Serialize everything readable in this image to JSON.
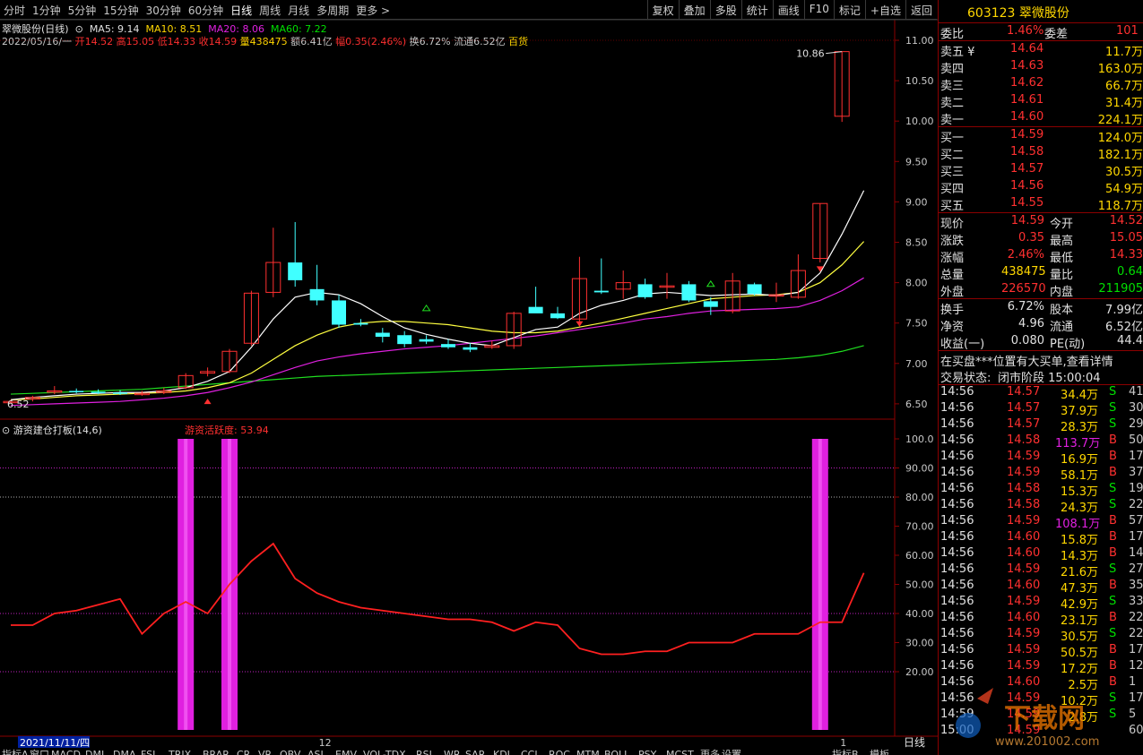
{
  "toolbar": {
    "periods": [
      "分时",
      "1分钟",
      "5分钟",
      "15分钟",
      "30分钟",
      "60分钟",
      "日线",
      "周线",
      "月线",
      "多周期",
      "更多 >"
    ],
    "active_period": "日线",
    "buttons": [
      "复权",
      "叠加",
      "多股",
      "统计",
      "画线",
      "F10",
      "标记",
      "+自选",
      "返回"
    ]
  },
  "chart": {
    "stock_label": "翠微股份(日线)",
    "ma5": "MA5: 9.14",
    "ma10": "MA10: 8.51",
    "ma20": "MA20: 8.06",
    "ma60": "MA60: 7.22",
    "date_line": "2022/05/16/一",
    "open": "开14.52",
    "high": "高15.05",
    "low": "低14.33",
    "close": "收14.59",
    "volume": "量438475",
    "amount": "额6.41亿",
    "change": "幅0.35(2.46%)",
    "turnover": "换6.72%",
    "float": "流通6.52亿",
    "type": "百货",
    "price_axis": [
      "11.00",
      "10.50",
      "10.00",
      "9.50",
      "9.00",
      "8.50",
      "8.00",
      "7.50",
      "7.00",
      "6.50"
    ],
    "high_label": "10.86",
    "low_label": "6.52",
    "colors": {
      "up": "#ff3030",
      "down": "#40ffff",
      "ma5": "#ffffff",
      "ma10": "#ffff40",
      "ma20": "#e020e0",
      "ma60": "#20e020"
    }
  },
  "indicator": {
    "title": "游资建仓打板(14,6)",
    "value_label": "游资活跃度: 53.94",
    "axis": [
      "100.0",
      "90.00",
      "80.00",
      "70.00",
      "60.00",
      "50.00",
      "40.00",
      "30.00",
      "20.00"
    ]
  },
  "bottom": {
    "date_cursor": "2021/11/11/四",
    "month_12": "12",
    "month_1": "1",
    "period_label": "日线",
    "tabs": [
      "指标A",
      "窗口",
      "MACD",
      "DMI",
      "DMA",
      "FSL",
      "TRIX",
      "BRAR",
      "CR",
      "VR",
      "OBV",
      "ASI",
      "EMV",
      "VOL-TDX",
      "RSI",
      "WR",
      "SAR",
      "KDJ",
      "CCI",
      "ROC",
      "MTM",
      "BOLL",
      "PSY",
      "MCST",
      "更多",
      "设置"
    ],
    "tabs_right": [
      "指标B",
      "模板"
    ]
  },
  "quote": {
    "code": "603123",
    "name": "翠微股份",
    "weibi_label": "委比",
    "weibi": "1.46%",
    "weicha_label": "委差",
    "weicha": "101",
    "asks": [
      {
        "label": "卖五",
        "price": "14.64",
        "vol": "11.7万",
        "mark": "¥"
      },
      {
        "label": "卖四",
        "price": "14.63",
        "vol": "163.0万"
      },
      {
        "label": "卖三",
        "price": "14.62",
        "vol": "66.7万"
      },
      {
        "label": "卖二",
        "price": "14.61",
        "vol": "31.4万"
      },
      {
        "label": "卖一",
        "price": "14.60",
        "vol": "224.1万"
      }
    ],
    "bids": [
      {
        "label": "买一",
        "price": "14.59",
        "vol": "124.0万"
      },
      {
        "label": "买二",
        "price": "14.58",
        "vol": "182.1万"
      },
      {
        "label": "买三",
        "price": "14.57",
        "vol": "30.5万"
      },
      {
        "label": "买四",
        "price": "14.56",
        "vol": "54.9万"
      },
      {
        "label": "买五",
        "price": "14.55",
        "vol": "118.7万"
      }
    ],
    "stats": [
      {
        "l1": "现价",
        "v1": "14.59",
        "l2": "今开",
        "v2": "14.52",
        "c1": "red",
        "c2": "red"
      },
      {
        "l1": "涨跌",
        "v1": "0.35",
        "l2": "最高",
        "v2": "15.05",
        "c1": "red",
        "c2": "red"
      },
      {
        "l1": "涨幅",
        "v1": "2.46%",
        "l2": "最低",
        "v2": "14.33",
        "c1": "red",
        "c2": "red"
      },
      {
        "l1": "总量",
        "v1": "438475",
        "l2": "量比",
        "v2": "0.64",
        "c1": "yellow",
        "c2": "green"
      },
      {
        "l1": "外盘",
        "v1": "226570",
        "l2": "内盘",
        "v2": "211905",
        "c1": "red",
        "c2": "green"
      }
    ],
    "stats2": [
      {
        "l1": "换手",
        "v1": "6.72%",
        "l2": "股本",
        "v2": "7.99亿"
      },
      {
        "l1": "净资",
        "v1": "4.96",
        "l2": "流通",
        "v2": "6.52亿"
      },
      {
        "l1": "收益(一)",
        "v1": "0.080",
        "l2": "PE(动)",
        "v2": "44.4"
      }
    ],
    "notice": "在买盘***位置有大买单,查看详情",
    "status_label": "交易状态:",
    "status": "闭市阶段 15:00:04",
    "ticks": [
      {
        "t": "14:56",
        "p": "14.57",
        "v": "34.4万",
        "s": "S",
        "n": "41"
      },
      {
        "t": "14:56",
        "p": "14.57",
        "v": "37.9万",
        "s": "S",
        "n": "30"
      },
      {
        "t": "14:56",
        "p": "14.57",
        "v": "28.3万",
        "s": "S",
        "n": "29"
      },
      {
        "t": "14:56",
        "p": "14.58",
        "v": "113.7万",
        "s": "B",
        "n": "50"
      },
      {
        "t": "14:56",
        "p": "14.59",
        "v": "16.9万",
        "s": "B",
        "n": "17"
      },
      {
        "t": "14:56",
        "p": "14.59",
        "v": "58.1万",
        "s": "B",
        "n": "37"
      },
      {
        "t": "14:56",
        "p": "14.58",
        "v": "15.3万",
        "s": "S",
        "n": "19"
      },
      {
        "t": "14:56",
        "p": "14.58",
        "v": "24.3万",
        "s": "S",
        "n": "22"
      },
      {
        "t": "14:56",
        "p": "14.59",
        "v": "108.1万",
        "s": "B",
        "n": "57"
      },
      {
        "t": "14:56",
        "p": "14.60",
        "v": "15.8万",
        "s": "B",
        "n": "17"
      },
      {
        "t": "14:56",
        "p": "14.60",
        "v": "14.3万",
        "s": "B",
        "n": "14"
      },
      {
        "t": "14:56",
        "p": "14.59",
        "v": "21.6万",
        "s": "S",
        "n": "27"
      },
      {
        "t": "14:56",
        "p": "14.60",
        "v": "47.3万",
        "s": "B",
        "n": "35"
      },
      {
        "t": "14:56",
        "p": "14.59",
        "v": "42.9万",
        "s": "S",
        "n": "33"
      },
      {
        "t": "14:56",
        "p": "14.60",
        "v": "23.1万",
        "s": "B",
        "n": "22"
      },
      {
        "t": "14:56",
        "p": "14.59",
        "v": "30.5万",
        "s": "S",
        "n": "22"
      },
      {
        "t": "14:56",
        "p": "14.59",
        "v": "50.5万",
        "s": "B",
        "n": "17"
      },
      {
        "t": "14:56",
        "p": "14.59",
        "v": "17.2万",
        "s": "B",
        "n": "12"
      },
      {
        "t": "14:56",
        "p": "14.60",
        "v": "2.5万",
        "s": "B",
        "n": "1"
      },
      {
        "t": "14:56",
        "p": "14.59",
        "v": "10.2万",
        "s": "S",
        "n": "17"
      },
      {
        "t": "14:59",
        "p": "14.59",
        "v": "2.8万",
        "s": "S",
        "n": "5"
      },
      {
        "t": "15:00",
        "p": "14.59",
        "v": "",
        "s": "",
        "n": "600"
      }
    ],
    "watermark": "下载网",
    "watermark_url": "www.201002.com"
  },
  "chart_data": {
    "type": "candlestick",
    "candles": [
      [
        6.52,
        6.55,
        6.5,
        6.53
      ],
      [
        6.56,
        6.6,
        6.53,
        6.58
      ],
      [
        6.66,
        6.72,
        6.62,
        6.66
      ],
      [
        6.66,
        6.69,
        6.63,
        6.65
      ],
      [
        6.65,
        6.68,
        6.62,
        6.64
      ],
      [
        6.64,
        6.67,
        6.61,
        6.63
      ],
      [
        6.63,
        6.66,
        6.6,
        6.63
      ],
      [
        6.64,
        6.7,
        6.62,
        6.66
      ],
      [
        6.7,
        6.88,
        6.68,
        6.85
      ],
      [
        6.88,
        6.95,
        6.84,
        6.9
      ],
      [
        6.9,
        7.18,
        6.88,
        7.15
      ],
      [
        7.25,
        7.9,
        7.22,
        7.87
      ],
      [
        7.88,
        8.68,
        7.82,
        8.25
      ],
      [
        8.25,
        8.75,
        7.95,
        8.03
      ],
      [
        7.92,
        8.22,
        7.72,
        7.78
      ],
      [
        7.78,
        7.85,
        7.44,
        7.48
      ],
      [
        7.5,
        7.55,
        7.46,
        7.48
      ],
      [
        7.38,
        7.44,
        7.26,
        7.33
      ],
      [
        7.35,
        7.4,
        7.2,
        7.24
      ],
      [
        7.3,
        7.35,
        7.24,
        7.27
      ],
      [
        7.24,
        7.3,
        7.18,
        7.2
      ],
      [
        7.2,
        7.25,
        7.14,
        7.17
      ],
      [
        7.2,
        7.28,
        7.18,
        7.22
      ],
      [
        7.22,
        7.64,
        7.18,
        7.62
      ],
      [
        7.7,
        7.95,
        7.65,
        7.62
      ],
      [
        7.62,
        7.7,
        7.55,
        7.56
      ],
      [
        7.55,
        8.32,
        7.52,
        8.05
      ],
      [
        7.9,
        8.3,
        7.86,
        7.88
      ],
      [
        7.92,
        8.15,
        7.8,
        8.0
      ],
      [
        7.98,
        8.05,
        7.8,
        7.82
      ],
      [
        7.96,
        8.12,
        7.8,
        7.96
      ],
      [
        7.98,
        8.02,
        7.76,
        7.78
      ],
      [
        7.77,
        7.82,
        7.6,
        7.7
      ],
      [
        7.65,
        8.12,
        7.62,
        8.02
      ],
      [
        7.98,
        8.0,
        7.84,
        7.86
      ],
      [
        7.84,
        8.0,
        7.76,
        7.85
      ],
      [
        7.82,
        8.35,
        7.8,
        8.15
      ],
      [
        8.3,
        8.98,
        8.25,
        8.98
      ],
      [
        10.06,
        10.86,
        9.99,
        10.86
      ],
      [
        14.52,
        15.05,
        14.33,
        14.59
      ]
    ],
    "ma5": [
      6.55,
      6.58,
      6.6,
      6.62,
      6.63,
      6.64,
      6.64,
      6.66,
      6.7,
      6.78,
      6.9,
      7.2,
      7.55,
      7.82,
      7.88,
      7.85,
      7.74,
      7.58,
      7.44,
      7.36,
      7.3,
      7.25,
      7.22,
      7.32,
      7.42,
      7.45,
      7.62,
      7.72,
      7.78,
      7.86,
      7.88,
      7.86,
      7.84,
      7.85,
      7.86,
      7.84,
      7.88,
      8.12,
      8.6,
      9.14
    ],
    "ma10": [
      6.55,
      6.56,
      6.58,
      6.6,
      6.61,
      6.62,
      6.63,
      6.64,
      6.66,
      6.7,
      6.76,
      6.88,
      7.05,
      7.22,
      7.35,
      7.45,
      7.5,
      7.52,
      7.52,
      7.5,
      7.48,
      7.44,
      7.4,
      7.38,
      7.38,
      7.4,
      7.45,
      7.5,
      7.56,
      7.62,
      7.68,
      7.74,
      7.8,
      7.82,
      7.84,
      7.85,
      7.88,
      8.0,
      8.22,
      8.51
    ],
    "ma20": [
      6.48,
      6.49,
      6.5,
      6.51,
      6.52,
      6.53,
      6.55,
      6.57,
      6.6,
      6.64,
      6.7,
      6.77,
      6.86,
      6.95,
      7.03,
      7.08,
      7.12,
      7.15,
      7.18,
      7.2,
      7.22,
      7.25,
      7.28,
      7.31,
      7.34,
      7.38,
      7.42,
      7.46,
      7.5,
      7.55,
      7.58,
      7.62,
      7.65,
      7.66,
      7.67,
      7.68,
      7.7,
      7.78,
      7.9,
      8.06
    ],
    "ma60": [
      6.62,
      6.63,
      6.64,
      6.65,
      6.66,
      6.67,
      6.68,
      6.7,
      6.72,
      6.74,
      6.76,
      6.78,
      6.8,
      6.82,
      6.84,
      6.85,
      6.86,
      6.87,
      6.88,
      6.89,
      6.9,
      6.91,
      6.92,
      6.93,
      6.94,
      6.95,
      6.96,
      6.97,
      6.98,
      6.99,
      7.0,
      7.01,
      7.02,
      7.03,
      7.04,
      7.05,
      7.07,
      7.1,
      7.15,
      7.22
    ],
    "y_range": [
      6.4,
      11.1
    ],
    "activity": [
      36,
      36,
      40,
      41,
      43,
      45,
      33,
      40,
      44,
      40,
      50,
      58,
      64,
      52,
      47,
      44,
      42,
      41,
      40,
      39,
      38,
      38,
      37,
      34,
      37,
      36,
      28,
      26,
      26,
      27,
      27,
      30,
      30,
      30,
      33,
      33,
      33,
      37,
      37,
      53.94
    ],
    "activity_range": [
      10,
      104
    ],
    "bars_at": [
      8,
      10,
      37
    ],
    "hlines": [
      90,
      80,
      40,
      20
    ]
  }
}
